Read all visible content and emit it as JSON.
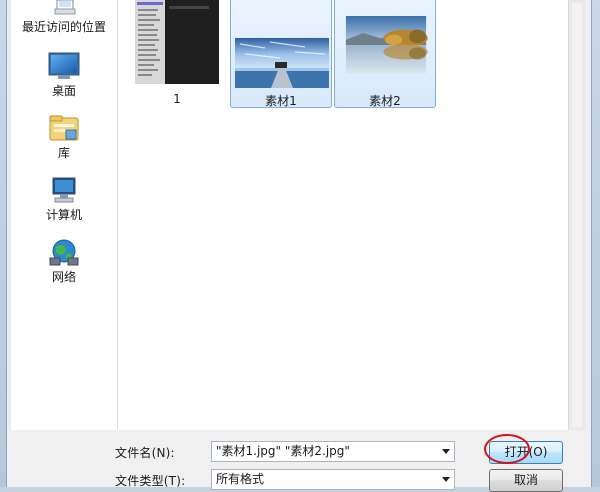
{
  "nav": {
    "items": [
      {
        "label": "最近访问的位置",
        "icon": "recent-places-icon"
      },
      {
        "label": "桌面",
        "icon": "desktop-icon"
      },
      {
        "label": "库",
        "icon": "library-icon"
      },
      {
        "label": "计算机",
        "icon": "computer-icon"
      },
      {
        "label": "网络",
        "icon": "network-icon"
      }
    ]
  },
  "files": [
    {
      "name": "1",
      "selected": false
    },
    {
      "name": "素材1",
      "selected": true
    },
    {
      "name": "素材2",
      "selected": true
    }
  ],
  "bottom": {
    "filename_label": "文件名(N):",
    "filename_value": "\"素材1.jpg\" \"素材2.jpg\"",
    "filetype_label": "文件类型(T):",
    "filetype_value": "所有格式",
    "open_button": "打开(O)",
    "cancel_button": "取消"
  },
  "colors": {
    "selection_bg": "#d8e9fb",
    "selection_border": "#84acdd",
    "highlight_ring": "#d2141b"
  }
}
